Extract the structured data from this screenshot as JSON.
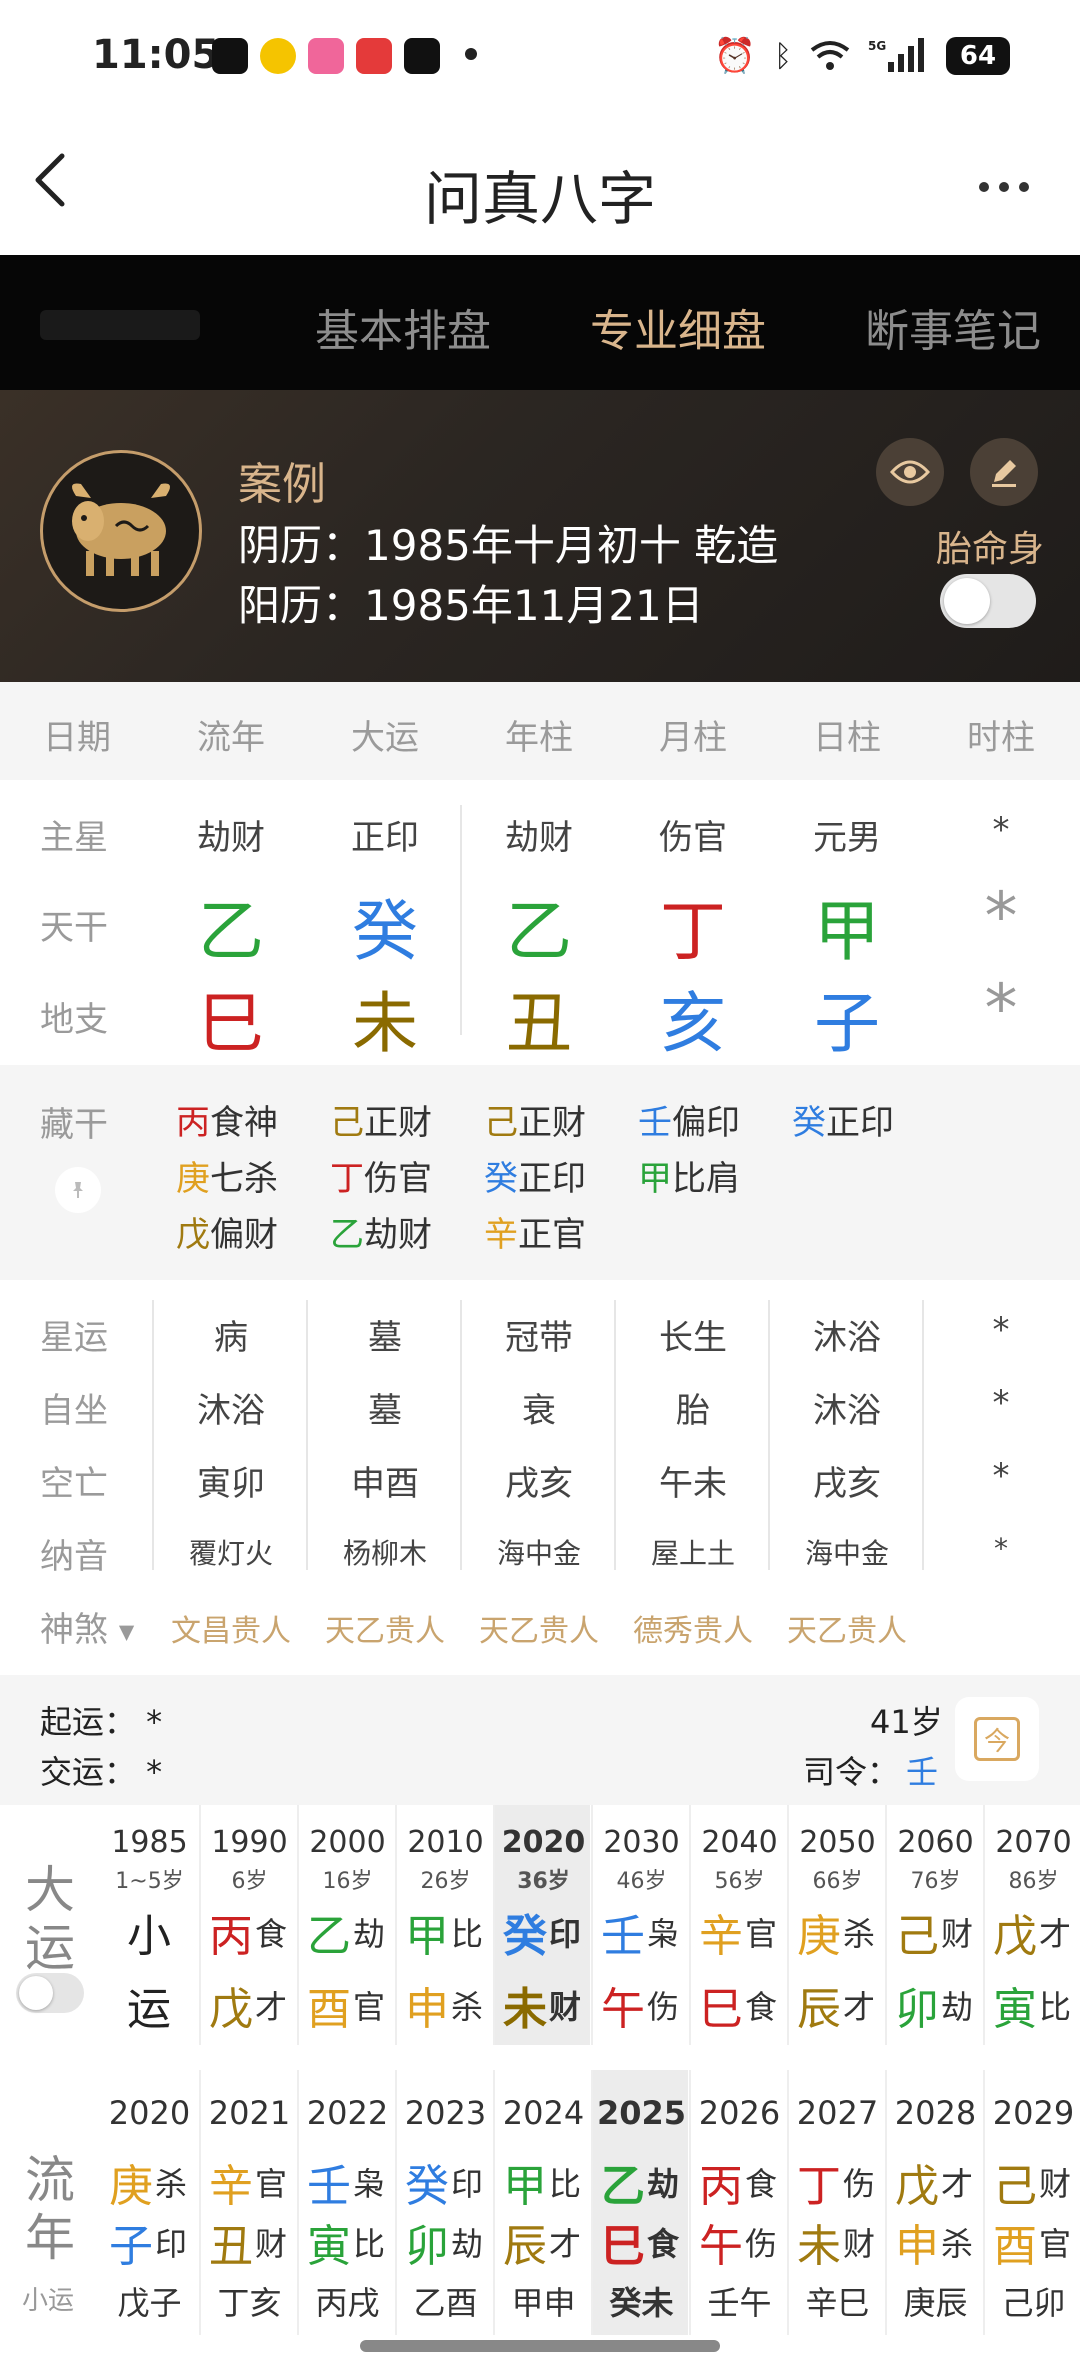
{
  "status_bar": {
    "time": "11:05",
    "battery": "64",
    "signal": "5G"
  },
  "header": {
    "title": "问真八字"
  },
  "tabs": [
    {
      "label": "基本排盘",
      "active": false
    },
    {
      "label": "专业细盘",
      "active": true
    },
    {
      "label": "断事笔记",
      "active": false
    }
  ],
  "profile": {
    "case_label": "案例",
    "lunar": "阴历：1985年十月初十 乾造",
    "solar": "阳历：1985年11月21日",
    "taiming_label": "胎命身"
  },
  "columns": [
    "日期",
    "流年",
    "大运",
    "年柱",
    "月柱",
    "日柱",
    "时柱"
  ],
  "main_star": {
    "label": "主星",
    "values": [
      "劫财",
      "正印",
      "劫财",
      "伤官",
      "元男",
      "*"
    ]
  },
  "tiangan": {
    "label": "天干",
    "values": [
      {
        "c": "乙",
        "color": "#2aa33a"
      },
      {
        "c": "癸",
        "color": "#2f7de0"
      },
      {
        "c": "乙",
        "color": "#2aa33a"
      },
      {
        "c": "丁",
        "color": "#cc2222"
      },
      {
        "c": "甲",
        "color": "#2aa33a"
      },
      {
        "c": "*",
        "color": "#999999"
      }
    ]
  },
  "dizhi": {
    "label": "地支",
    "values": [
      {
        "c": "巳",
        "color": "#cc2222"
      },
      {
        "c": "未",
        "color": "#8a6a00"
      },
      {
        "c": "丑",
        "color": "#8a6a00"
      },
      {
        "c": "亥",
        "color": "#2f7de0"
      },
      {
        "c": "子",
        "color": "#2f7de0"
      },
      {
        "c": "*",
        "color": "#999999"
      }
    ]
  },
  "canggan": {
    "label": "藏干",
    "columns": [
      [
        {
          "c": "丙",
          "color": "#cc2222",
          "t": "食神"
        },
        {
          "c": "庚",
          "color": "#e0a020",
          "t": "七杀"
        },
        {
          "c": "戊",
          "color": "#a07a10",
          "t": "偏财"
        }
      ],
      [
        {
          "c": "己",
          "color": "#a07a10",
          "t": "正财"
        },
        {
          "c": "丁",
          "color": "#cc2222",
          "t": "伤官"
        },
        {
          "c": "乙",
          "color": "#2aa33a",
          "t": "劫财"
        }
      ],
      [
        {
          "c": "己",
          "color": "#a07a10",
          "t": "正财"
        },
        {
          "c": "癸",
          "color": "#2f7de0",
          "t": "正印"
        },
        {
          "c": "辛",
          "color": "#e0a020",
          "t": "正官"
        }
      ],
      [
        {
          "c": "壬",
          "color": "#2f7de0",
          "t": "偏印"
        },
        {
          "c": "甲",
          "color": "#2aa33a",
          "t": "比肩"
        }
      ],
      [
        {
          "c": "癸",
          "color": "#2f7de0",
          "t": "正印"
        }
      ]
    ]
  },
  "xingyun": {
    "label": "星运",
    "values": [
      "病",
      "墓",
      "冠带",
      "长生",
      "沐浴",
      "*"
    ]
  },
  "zizuo": {
    "label": "自坐",
    "values": [
      "沐浴",
      "墓",
      "衰",
      "胎",
      "沐浴",
      "*"
    ]
  },
  "kongwang": {
    "label": "空亡",
    "values": [
      "寅卯",
      "申酉",
      "戌亥",
      "午未",
      "戌亥",
      "*"
    ]
  },
  "nayin": {
    "label": "纳音",
    "values": [
      "覆灯火",
      "杨柳木",
      "海中金",
      "屋上土",
      "海中金",
      "*"
    ]
  },
  "shensha": {
    "label": "神煞",
    "values": [
      "文昌贵人",
      "天乙贵人",
      "天乙贵人",
      "德秀贵人",
      "天乙贵人"
    ]
  },
  "qiyun": {
    "start": "起运：  *",
    "jiao": "交运：  *",
    "age": "41岁",
    "siling_label": "司令：",
    "siling_value": "壬",
    "today_icon": "今"
  },
  "dayun": {
    "label_top": "大",
    "label_bottom": "运",
    "items": [
      {
        "year": "1985",
        "age": "1~5岁",
        "g": "小",
        "gc": "#222222",
        "gs": "",
        "z": "运",
        "zc": "#222222",
        "zs": ""
      },
      {
        "year": "1990",
        "age": "6岁",
        "g": "丙",
        "gc": "#cc2222",
        "gs": "食",
        "z": "戊",
        "zc": "#a07a10",
        "zs": "才"
      },
      {
        "year": "2000",
        "age": "16岁",
        "g": "乙",
        "gc": "#2aa33a",
        "gs": "劫",
        "z": "酉",
        "zc": "#e0a020",
        "zs": "官"
      },
      {
        "year": "2010",
        "age": "26岁",
        "g": "甲",
        "gc": "#2aa33a",
        "gs": "比",
        "z": "申",
        "zc": "#e0a020",
        "zs": "杀"
      },
      {
        "year": "2020",
        "age": "36岁",
        "g": "癸",
        "gc": "#2f7de0",
        "gs": "印",
        "z": "未",
        "zc": "#8a6a00",
        "zs": "财",
        "active": true
      },
      {
        "year": "2030",
        "age": "46岁",
        "g": "壬",
        "gc": "#2f7de0",
        "gs": "枭",
        "z": "午",
        "zc": "#cc2222",
        "zs": "伤"
      },
      {
        "year": "2040",
        "age": "56岁",
        "g": "辛",
        "gc": "#e0a020",
        "gs": "官",
        "z": "巳",
        "zc": "#cc2222",
        "zs": "食"
      },
      {
        "year": "2050",
        "age": "66岁",
        "g": "庚",
        "gc": "#e0a020",
        "gs": "杀",
        "z": "辰",
        "zc": "#a07a10",
        "zs": "才"
      },
      {
        "year": "2060",
        "age": "76岁",
        "g": "己",
        "gc": "#a07a10",
        "gs": "财",
        "z": "卯",
        "zc": "#2aa33a",
        "zs": "劫"
      },
      {
        "year": "2070",
        "age": "86岁",
        "g": "戊",
        "gc": "#a07a10",
        "gs": "才",
        "z": "寅",
        "zc": "#2aa33a",
        "zs": "比"
      }
    ]
  },
  "liunian": {
    "label_top": "流",
    "label_bottom": "年",
    "sub_label": "小运",
    "items": [
      {
        "year": "2020",
        "g": "庚",
        "gc": "#e0a020",
        "gs": "杀",
        "z": "子",
        "zc": "#2f7de0",
        "zs": "印",
        "x": "戊子"
      },
      {
        "year": "2021",
        "g": "辛",
        "gc": "#e0a020",
        "gs": "官",
        "z": "丑",
        "zc": "#a07a10",
        "zs": "财",
        "x": "丁亥"
      },
      {
        "year": "2022",
        "g": "壬",
        "gc": "#2f7de0",
        "gs": "枭",
        "z": "寅",
        "zc": "#2aa33a",
        "zs": "比",
        "x": "丙戌"
      },
      {
        "year": "2023",
        "g": "癸",
        "gc": "#2f7de0",
        "gs": "印",
        "z": "卯",
        "zc": "#2aa33a",
        "zs": "劫",
        "x": "乙酉"
      },
      {
        "year": "2024",
        "g": "甲",
        "gc": "#2aa33a",
        "gs": "比",
        "z": "辰",
        "zc": "#a07a10",
        "zs": "才",
        "x": "甲申"
      },
      {
        "year": "2025",
        "g": "乙",
        "gc": "#2aa33a",
        "gs": "劫",
        "z": "巳",
        "zc": "#cc2222",
        "zs": "食",
        "x": "癸未",
        "active": true
      },
      {
        "year": "2026",
        "g": "丙",
        "gc": "#cc2222",
        "gs": "食",
        "z": "午",
        "zc": "#cc2222",
        "zs": "伤",
        "x": "壬午"
      },
      {
        "year": "2027",
        "g": "丁",
        "gc": "#cc2222",
        "gs": "伤",
        "z": "未",
        "zc": "#a07a10",
        "zs": "财",
        "x": "辛巳"
      },
      {
        "year": "2028",
        "g": "戊",
        "gc": "#a07a10",
        "gs": "才",
        "z": "申",
        "zc": "#e0a020",
        "zs": "杀",
        "x": "庚辰"
      },
      {
        "year": "2029",
        "g": "己",
        "gc": "#a07a10",
        "gs": "财",
        "z": "酉",
        "zc": "#e0a020",
        "zs": "官",
        "x": "己卯"
      }
    ]
  }
}
